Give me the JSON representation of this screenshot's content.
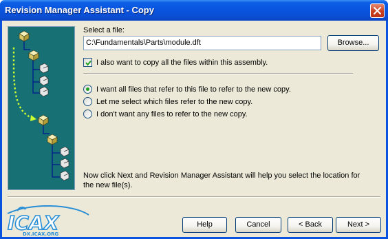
{
  "window": {
    "title": "Revision Manager Assistant - Copy"
  },
  "file_select": {
    "label": "Select a file:",
    "value": "C:\\Fundamentals\\Parts\\module.dft",
    "browse_label": "Browse..."
  },
  "copy_assembly_checkbox": {
    "label": "I also want to copy all the files within this assembly.",
    "checked": true
  },
  "reference_options": {
    "selected_index": 0,
    "items": [
      {
        "label": "I want all files that refer to this file to refer to the new copy."
      },
      {
        "label": "Let me select which files refer to the new copy."
      },
      {
        "label": "I don't want any files to refer to the new copy."
      }
    ]
  },
  "instructions": {
    "line1": "Now click Next and Revision Manager Assistant will help you select the location for",
    "line2": "the new file(s)."
  },
  "footer": {
    "help_label": "Help",
    "cancel_label": "Cancel",
    "back_label": "< Back",
    "next_label": "Next >"
  },
  "watermark": {
    "logo_text": "ICAX",
    "url_text": "DX.ICAX.ORG"
  },
  "colors": {
    "titlebar": "#0a55df",
    "panel_bg": "#177074",
    "dialog_bg": "#ece9d8",
    "dotted_arrow": "#ccff33",
    "tree_line": "#001a8c",
    "logo": "#2a8fd6"
  }
}
